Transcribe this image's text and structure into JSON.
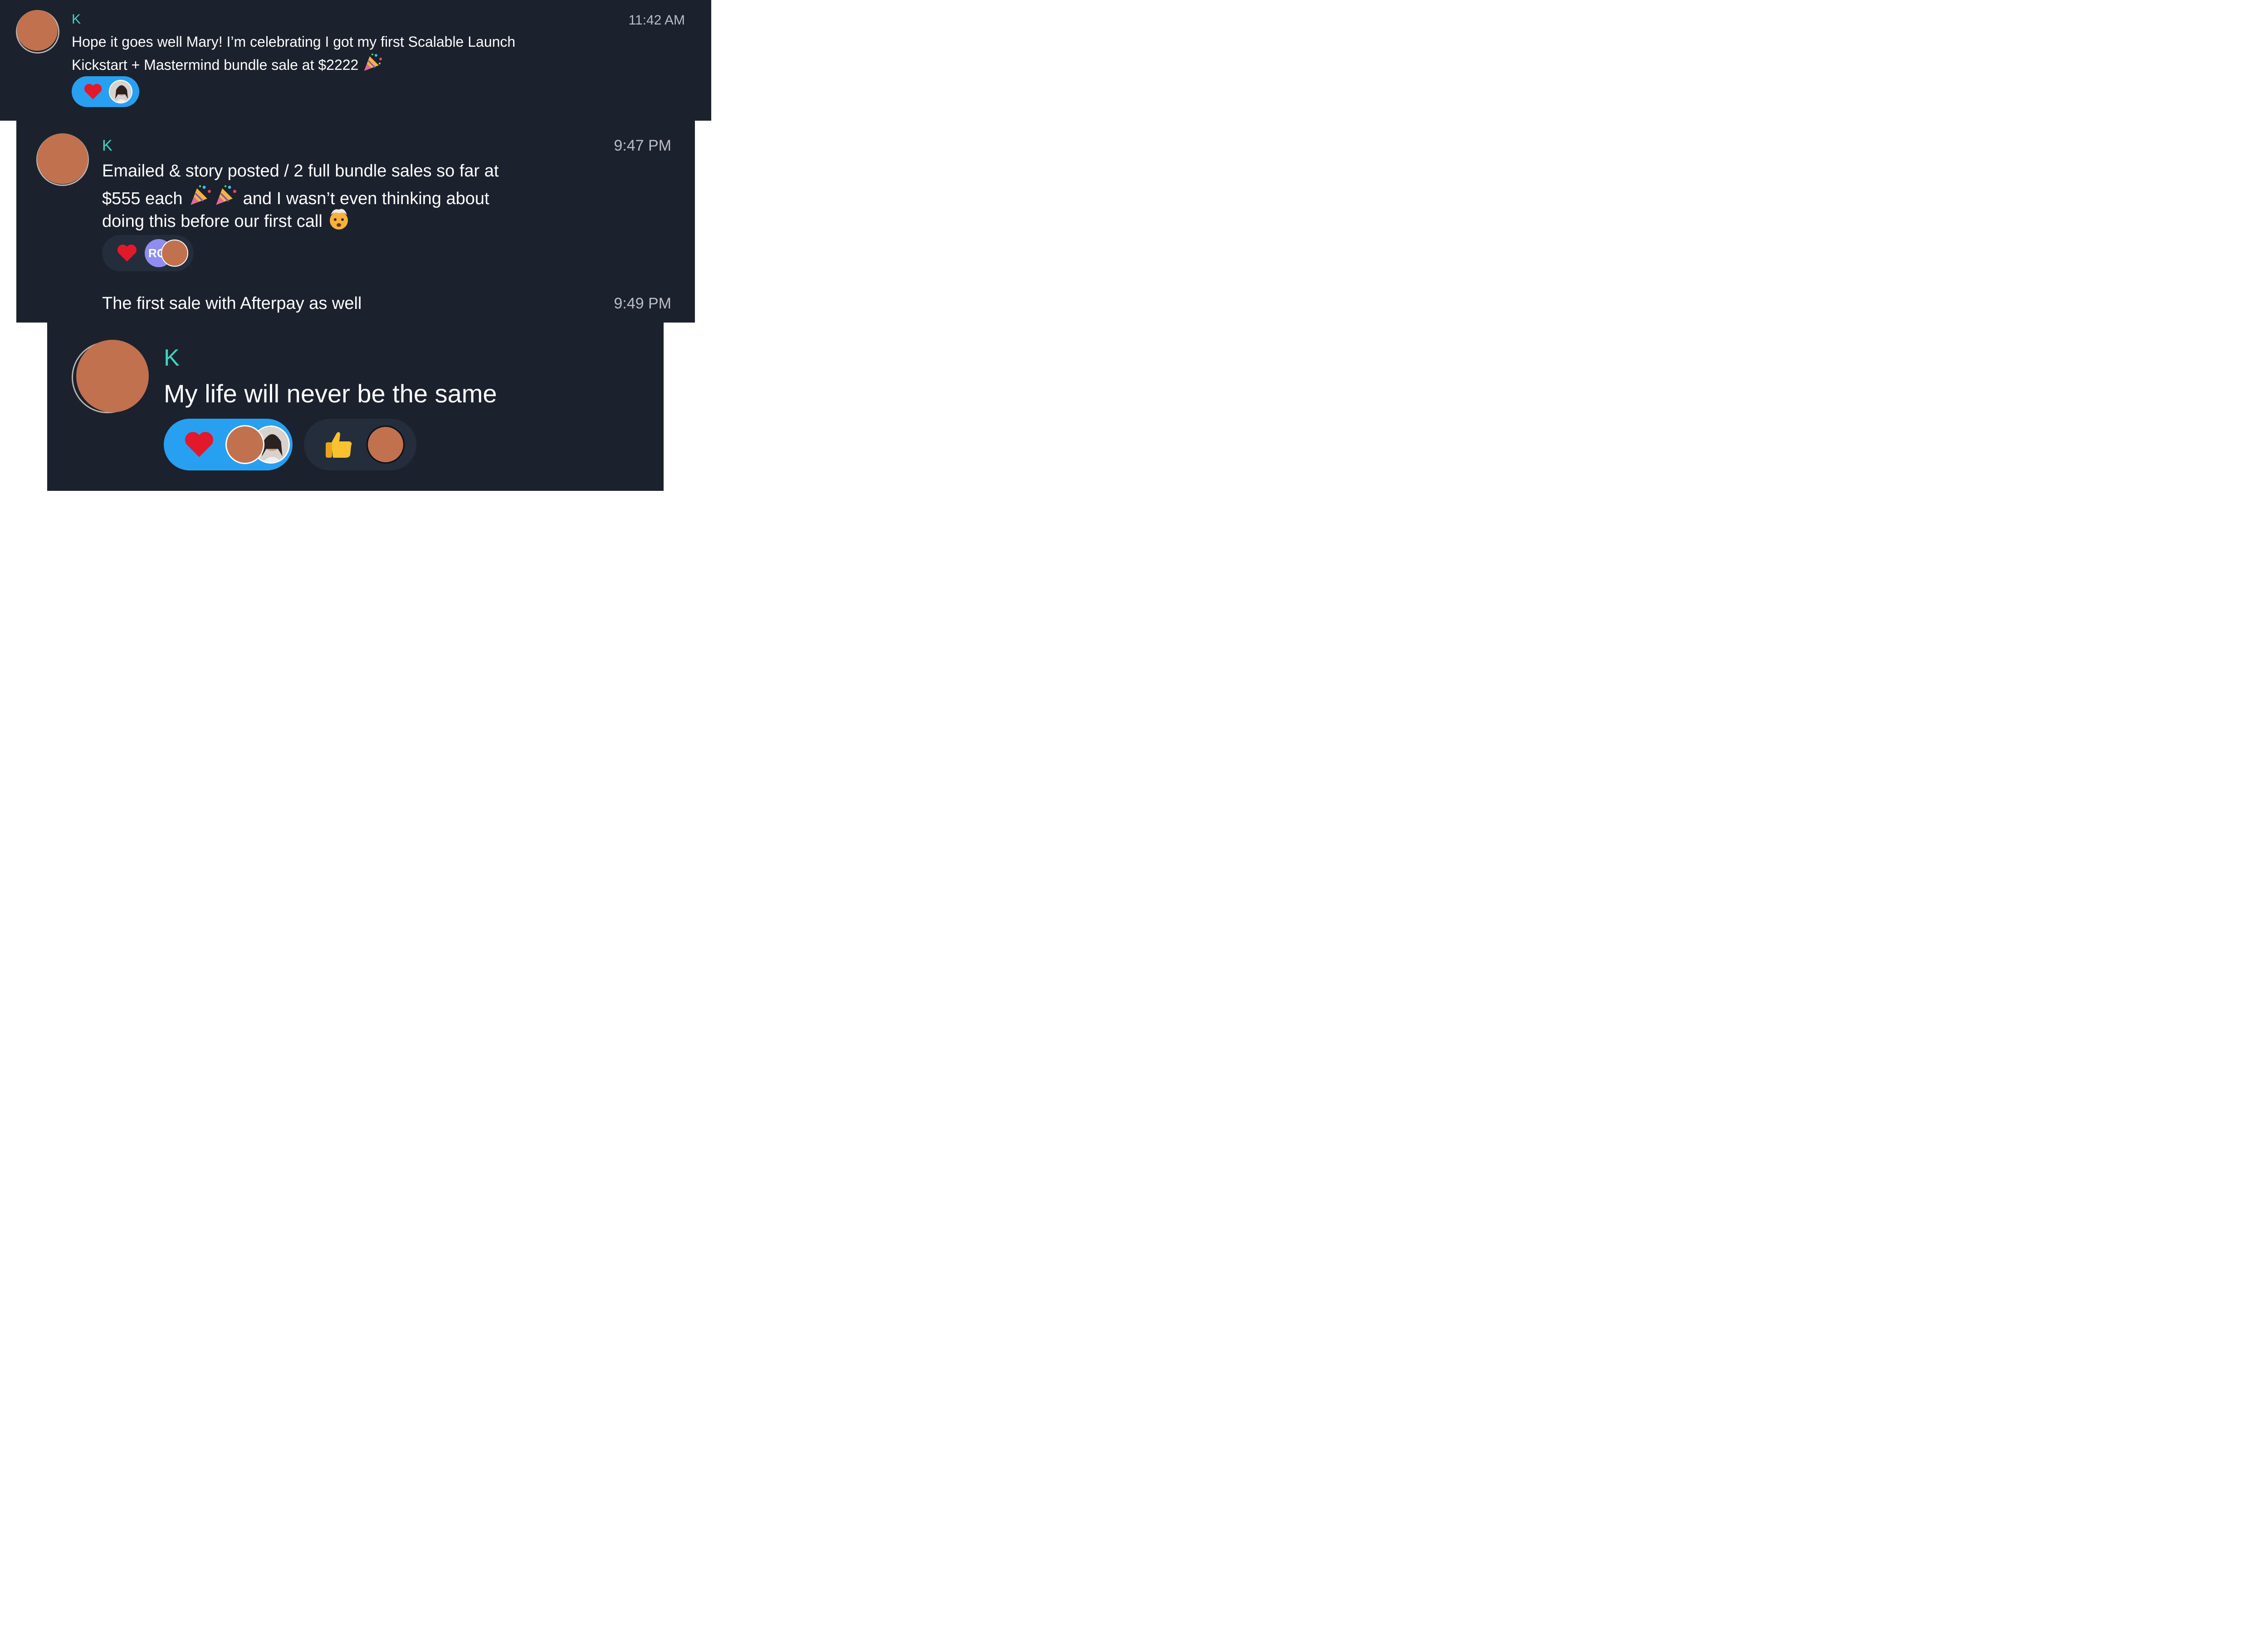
{
  "colors": {
    "panel_bg": "#1b222d",
    "author": "#3dd6c2",
    "message": "#ffffff",
    "timestamp": "#b9bdc4",
    "reaction_active": "#27a0f2",
    "reaction_idle": "#232d3b",
    "redaction_blob": "#c2714f"
  },
  "messages": [
    {
      "author": "K",
      "time": "11:42 AM",
      "lines": [
        "Hope it goes well Mary! I’m celebrating I got my first Scalable Launch",
        "Kickstart + Mastermind bundle sale at $2222"
      ],
      "reactions": [
        {
          "emoji": "heart-icon",
          "active": true
        }
      ]
    },
    {
      "author": "K",
      "time": "9:47 PM",
      "lines": [
        "Emailed & story posted / 2 full bundle sales so far at",
        "$555 each",
        "and I wasn’t even thinking about",
        "doing this before our first call"
      ],
      "reactions": [
        {
          "emoji": "heart-icon",
          "active": false,
          "avatar_initials": "RC"
        }
      ],
      "followup": {
        "text": "The first sale with Afterpay as well",
        "time": "9:49 PM"
      }
    },
    {
      "author": "K",
      "lines": [
        "My life will never be the same"
      ],
      "reactions": [
        {
          "emoji": "heart-icon",
          "active": true
        },
        {
          "emoji": "thumbs-up-icon",
          "active": false
        }
      ]
    }
  ]
}
